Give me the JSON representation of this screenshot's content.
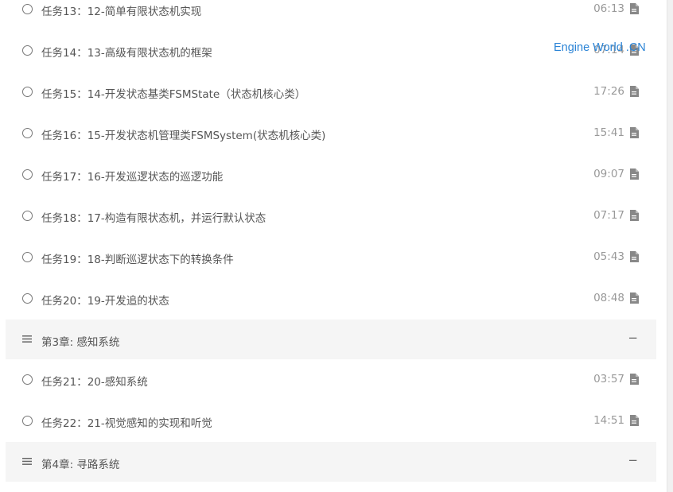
{
  "watermark": "Engine World .CN",
  "rows": [
    {
      "kind": "task",
      "label": "任务13：",
      "title": "12-简单有限状态机实现",
      "duration": "06:13"
    },
    {
      "kind": "task",
      "label": "任务14：",
      "title": "13-高级有限状态机的框架",
      "duration": "07:14"
    },
    {
      "kind": "task",
      "label": "任务15：",
      "title": "14-开发状态基类FSMState（状态机核心类）",
      "duration": "17:26"
    },
    {
      "kind": "task",
      "label": "任务16：",
      "title": "15-开发状态机管理类FSMSystem(状态机核心类)",
      "duration": "15:41"
    },
    {
      "kind": "task",
      "label": "任务17：",
      "title": "16-开发巡逻状态的巡逻功能",
      "duration": "09:07"
    },
    {
      "kind": "task",
      "label": "任务18：",
      "title": "17-构造有限状态机，并运行默认状态",
      "duration": "07:17"
    },
    {
      "kind": "task",
      "label": "任务19：",
      "title": "18-判断巡逻状态下的转换条件",
      "duration": "05:43"
    },
    {
      "kind": "task",
      "label": "任务20：",
      "title": "19-开发追的状态",
      "duration": "08:48"
    },
    {
      "kind": "chapter",
      "title": "第3章: 感知系统",
      "toggle": "−"
    },
    {
      "kind": "task",
      "label": "任务21：",
      "title": "20-感知系统",
      "duration": "03:57"
    },
    {
      "kind": "task",
      "label": "任务22：",
      "title": "21-视觉感知的实现和听觉",
      "duration": "14:51"
    },
    {
      "kind": "chapter",
      "title": "第4章: 寻路系统",
      "toggle": "−"
    }
  ]
}
